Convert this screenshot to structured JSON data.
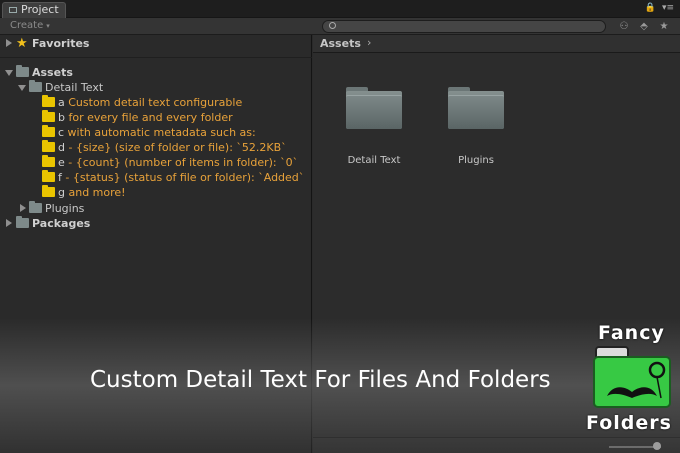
{
  "tabbar": {
    "tab_label": "Project",
    "controls": [
      "🔒",
      "▾≡"
    ]
  },
  "toolbar": {
    "create_label": "Create",
    "create_caret": "▾",
    "search_placeholder": "",
    "icons": [
      "scene-filter-icon",
      "label-tag-icon",
      "favorite-star-icon"
    ]
  },
  "tree": {
    "favorites_label": "Favorites",
    "assets_label": "Assets",
    "detail_text_label": "Detail Text",
    "detail_items": [
      {
        "letter": "a",
        "text": " Custom detail text configurable"
      },
      {
        "letter": "b",
        "text": " for every file and every folder"
      },
      {
        "letter": "c",
        "text": " with automatic metadata such as:"
      },
      {
        "letter": "d",
        "text": " - {size} (size of folder or file): `52.2KB`"
      },
      {
        "letter": "e",
        "text": " - {count} (number of items in folder): `0`"
      },
      {
        "letter": "f",
        "text": " - {status} (status of file or folder): `Added`"
      },
      {
        "letter": "g",
        "text": " and more!"
      }
    ],
    "plugins_label": "Plugins",
    "packages_label": "Packages"
  },
  "content": {
    "breadcrumb": "Assets",
    "breadcrumb_arrow": "›",
    "folders": [
      {
        "label": "Detail Text"
      },
      {
        "label": "Plugins"
      }
    ]
  },
  "banner": {
    "headline": "Custom Detail Text For Files And Folders"
  },
  "logo": {
    "top_word": "Fancy",
    "bottom_word": "Folders"
  },
  "colors": {
    "detail_text": "#e8a23a",
    "yellow_folder": "#e9c400",
    "logo_green": "#37c944"
  }
}
